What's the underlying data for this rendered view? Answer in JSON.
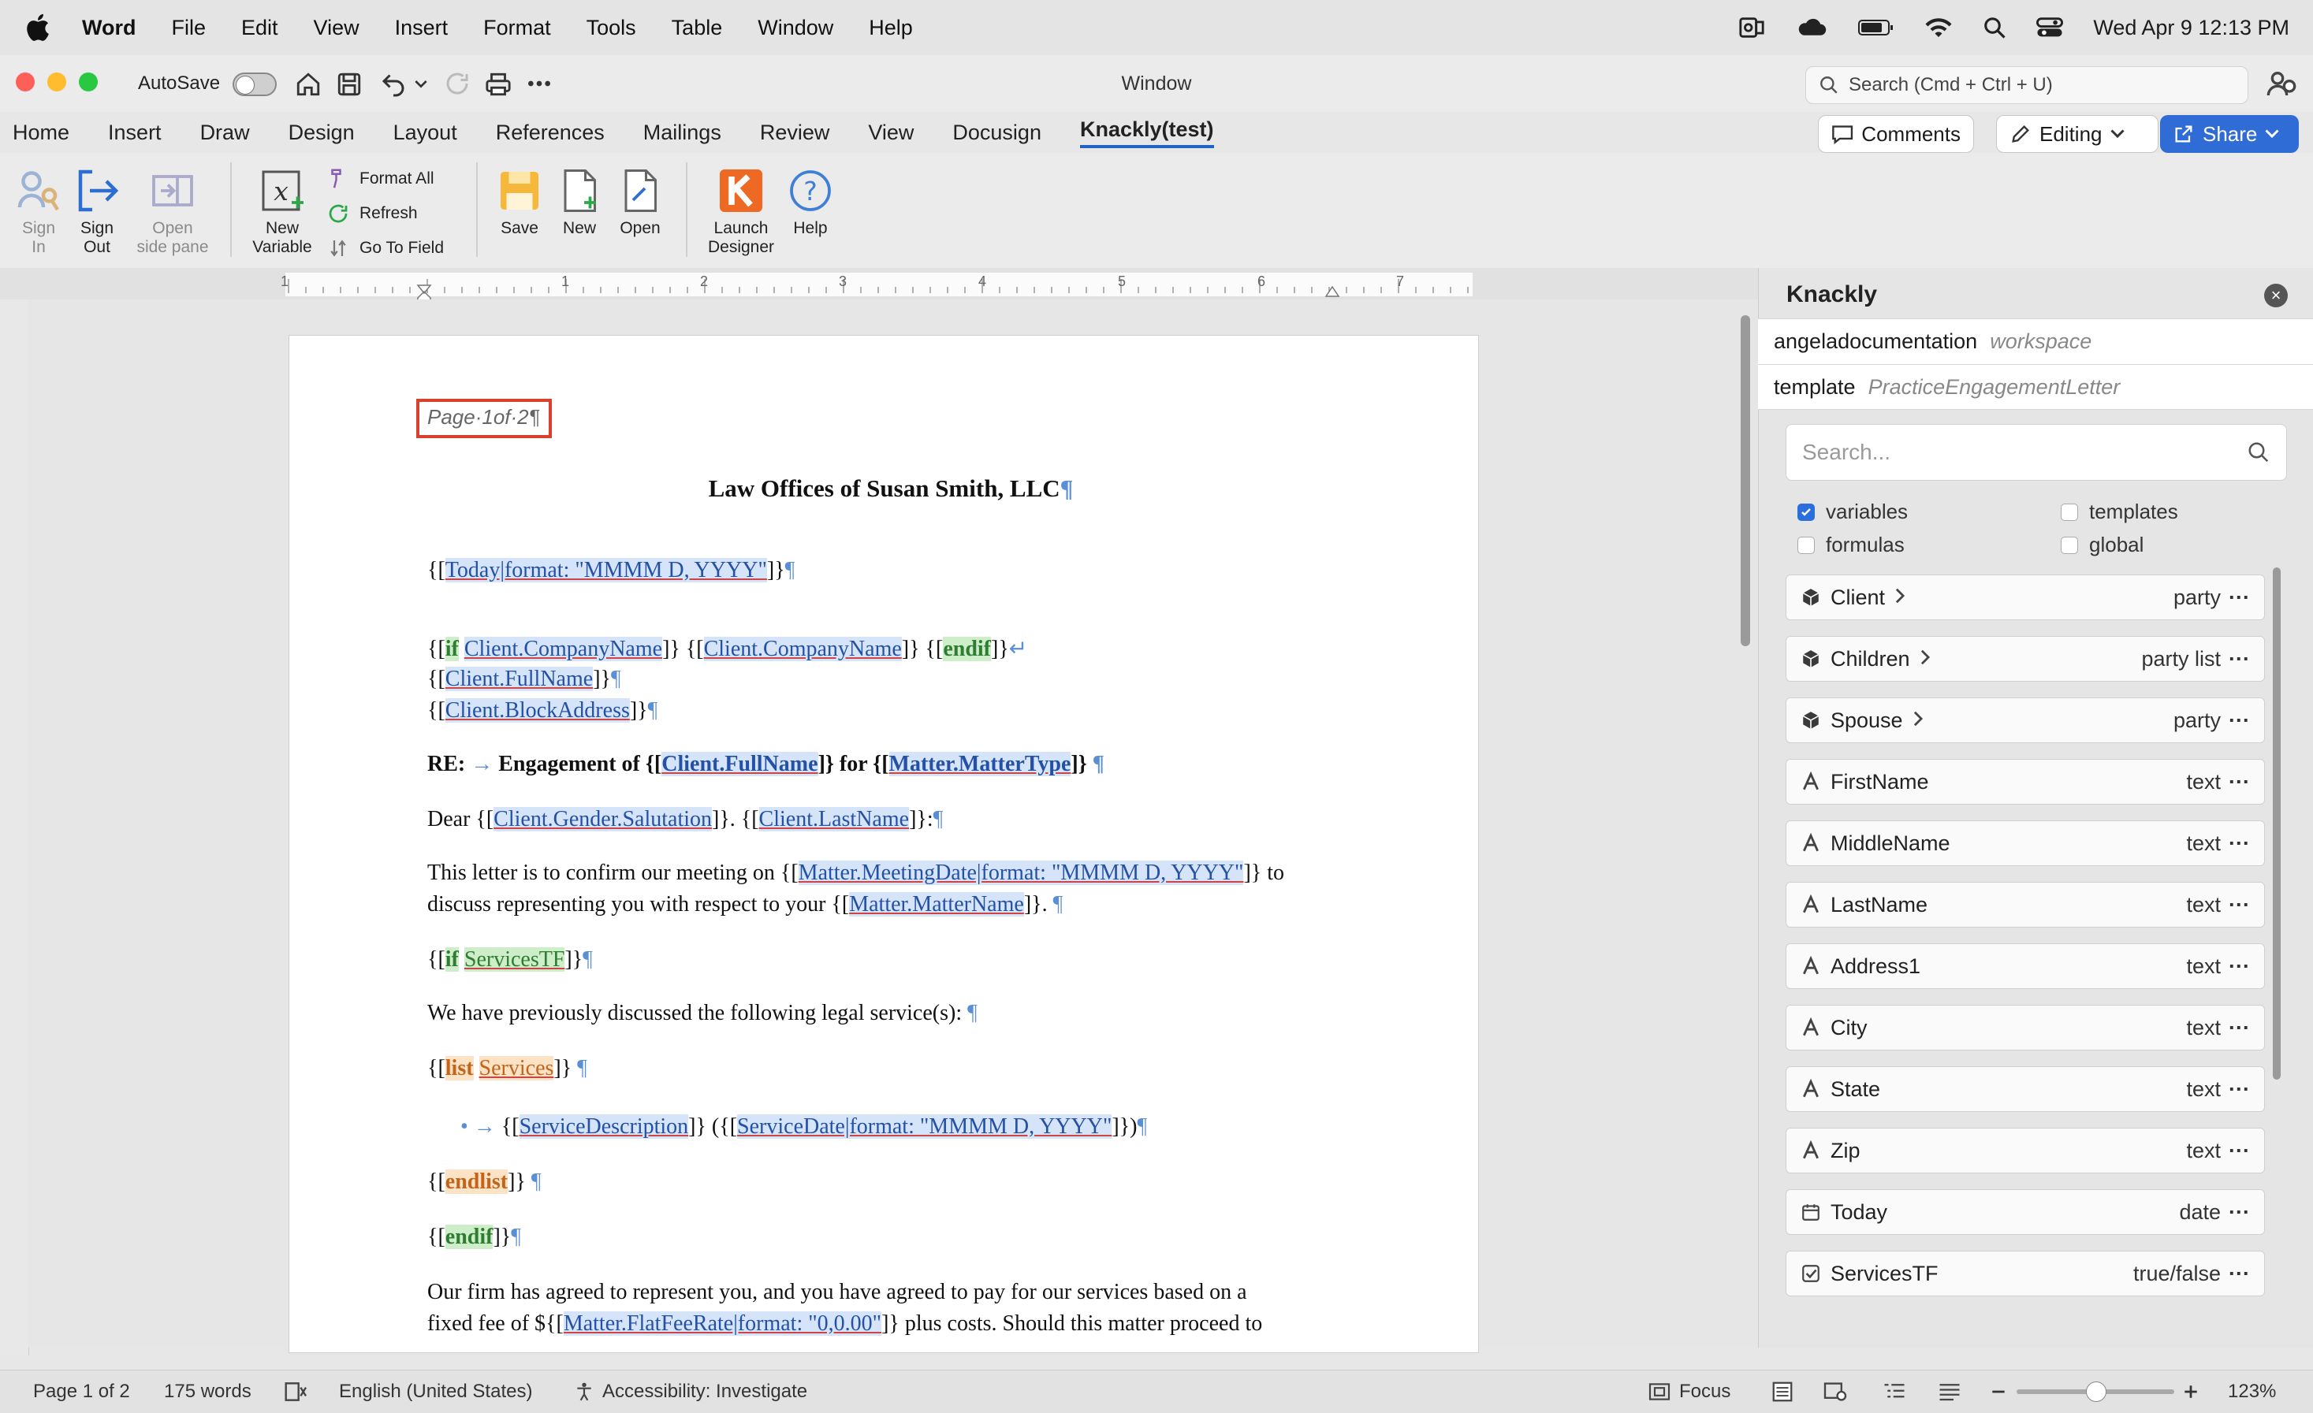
{
  "menubar": {
    "app": "Word",
    "items": [
      "File",
      "Edit",
      "View",
      "Insert",
      "Format",
      "Tools",
      "Table",
      "Window",
      "Help"
    ],
    "datetime": "Wed Apr 9  12:13 PM"
  },
  "window": {
    "title": "Window",
    "autosave_label": "AutoSave",
    "search_placeholder": "Search (Cmd + Ctrl + U)"
  },
  "tabs": [
    "Home",
    "Insert",
    "Draw",
    "Design",
    "Layout",
    "References",
    "Mailings",
    "Review",
    "View",
    "Docusign",
    "Knackly(test)"
  ],
  "top_buttons": {
    "comments": "Comments",
    "editing": "Editing",
    "share": "Share"
  },
  "ribbon": {
    "sign_in": "Sign\nIn",
    "sign_out": "Sign\nOut",
    "open_side_pane": "Open\nside pane",
    "new_variable": "New\nVariable",
    "format_all": "Format All",
    "refresh": "Refresh",
    "go_to_field": "Go To Field",
    "save": "Save",
    "new": "New",
    "open": "Open",
    "launch_designer": "Launch\nDesigner",
    "help": "Help"
  },
  "ruler_numbers": [
    "1",
    "1",
    "2",
    "3",
    "4",
    "5",
    "6",
    "7"
  ],
  "document": {
    "header_field": "Page·1of·2¶",
    "firm_title": "Law Offices of Susan Smith, LLC",
    "date_var": "Today|format: \"MMMM D, YYYY\"",
    "if_kw": "if",
    "company_var": "Client.CompanyName",
    "endif_kw": "endif",
    "fullname_var": "Client.FullName",
    "blockaddress_var": "Client.BlockAddress",
    "re_label": "RE:",
    "re_text1": "Engagement of {[",
    "re_fullname": "Client.FullName",
    "re_text2": "]} for {[",
    "re_mattertype": "Matter.MatterType",
    "re_text3": "]}",
    "dear": "Dear {[",
    "salutation_var": "Client.Gender.Salutation",
    "lastname_var": "Client.LastName",
    "p1a": "This letter is to confirm our meeting on {[",
    "meetingdate_var": "Matter.MeetingDate|format: \"MMMM D, YYYY\"",
    "p1b": "]} to",
    "p1c": "discuss representing you with respect to your {[",
    "mattername_var": "Matter.MatterName",
    "p1d": "]}.",
    "servicestf_var": "ServicesTF",
    "p2": "We have previously discussed the following legal service(s):",
    "list_kw": "list",
    "services_var": "Services",
    "servicedesc_var": "ServiceDescription",
    "servicedate_var": "ServiceDate|format: \"MMMM D, YYYY\"",
    "endlist_kw": "endlist",
    "p3a": "Our firm has agreed to represent you, and you have agreed to pay for our services based on a",
    "p3b": "fixed fee of ${[",
    "flatfee_var": "Matter.FlatFeeRate|format: \"0,0.00\"",
    "p3c": "]} plus costs.  Should this matter proceed to"
  },
  "panel": {
    "title": "Knackly",
    "workspace_name": "angeladocumentation",
    "workspace_label": "workspace",
    "template_label": "template",
    "template_name": "PracticeEngagementLetter",
    "search_placeholder": "Search...",
    "filters": [
      {
        "label": "variables",
        "checked": true
      },
      {
        "label": "templates",
        "checked": false
      },
      {
        "label": "formulas",
        "checked": false
      },
      {
        "label": "global",
        "checked": false
      }
    ],
    "variables": [
      {
        "name": "Client",
        "type": "party",
        "icon": "cube-icon",
        "chevron": true
      },
      {
        "name": "Children",
        "type": "party list",
        "icon": "cube-icon",
        "chevron": true
      },
      {
        "name": "Spouse",
        "type": "party",
        "icon": "cube-icon",
        "chevron": true
      },
      {
        "name": "FirstName",
        "type": "text",
        "icon": "text-type-icon",
        "chevron": false
      },
      {
        "name": "MiddleName",
        "type": "text",
        "icon": "text-type-icon",
        "chevron": false
      },
      {
        "name": "LastName",
        "type": "text",
        "icon": "text-type-icon",
        "chevron": false
      },
      {
        "name": "Address1",
        "type": "text",
        "icon": "text-type-icon",
        "chevron": false
      },
      {
        "name": "City",
        "type": "text",
        "icon": "text-type-icon",
        "chevron": false
      },
      {
        "name": "State",
        "type": "text",
        "icon": "text-type-icon",
        "chevron": false
      },
      {
        "name": "Zip",
        "type": "text",
        "icon": "text-type-icon",
        "chevron": false
      },
      {
        "name": "Today",
        "type": "date",
        "icon": "calendar-icon",
        "chevron": false
      },
      {
        "name": "ServicesTF",
        "type": "true/false",
        "icon": "checkbox-icon",
        "chevron": false
      }
    ]
  },
  "statusbar": {
    "page": "Page 1 of 2",
    "words": "175 words",
    "language": "English (United States)",
    "accessibility": "Accessibility: Investigate",
    "focus": "Focus",
    "zoom": "123%"
  }
}
